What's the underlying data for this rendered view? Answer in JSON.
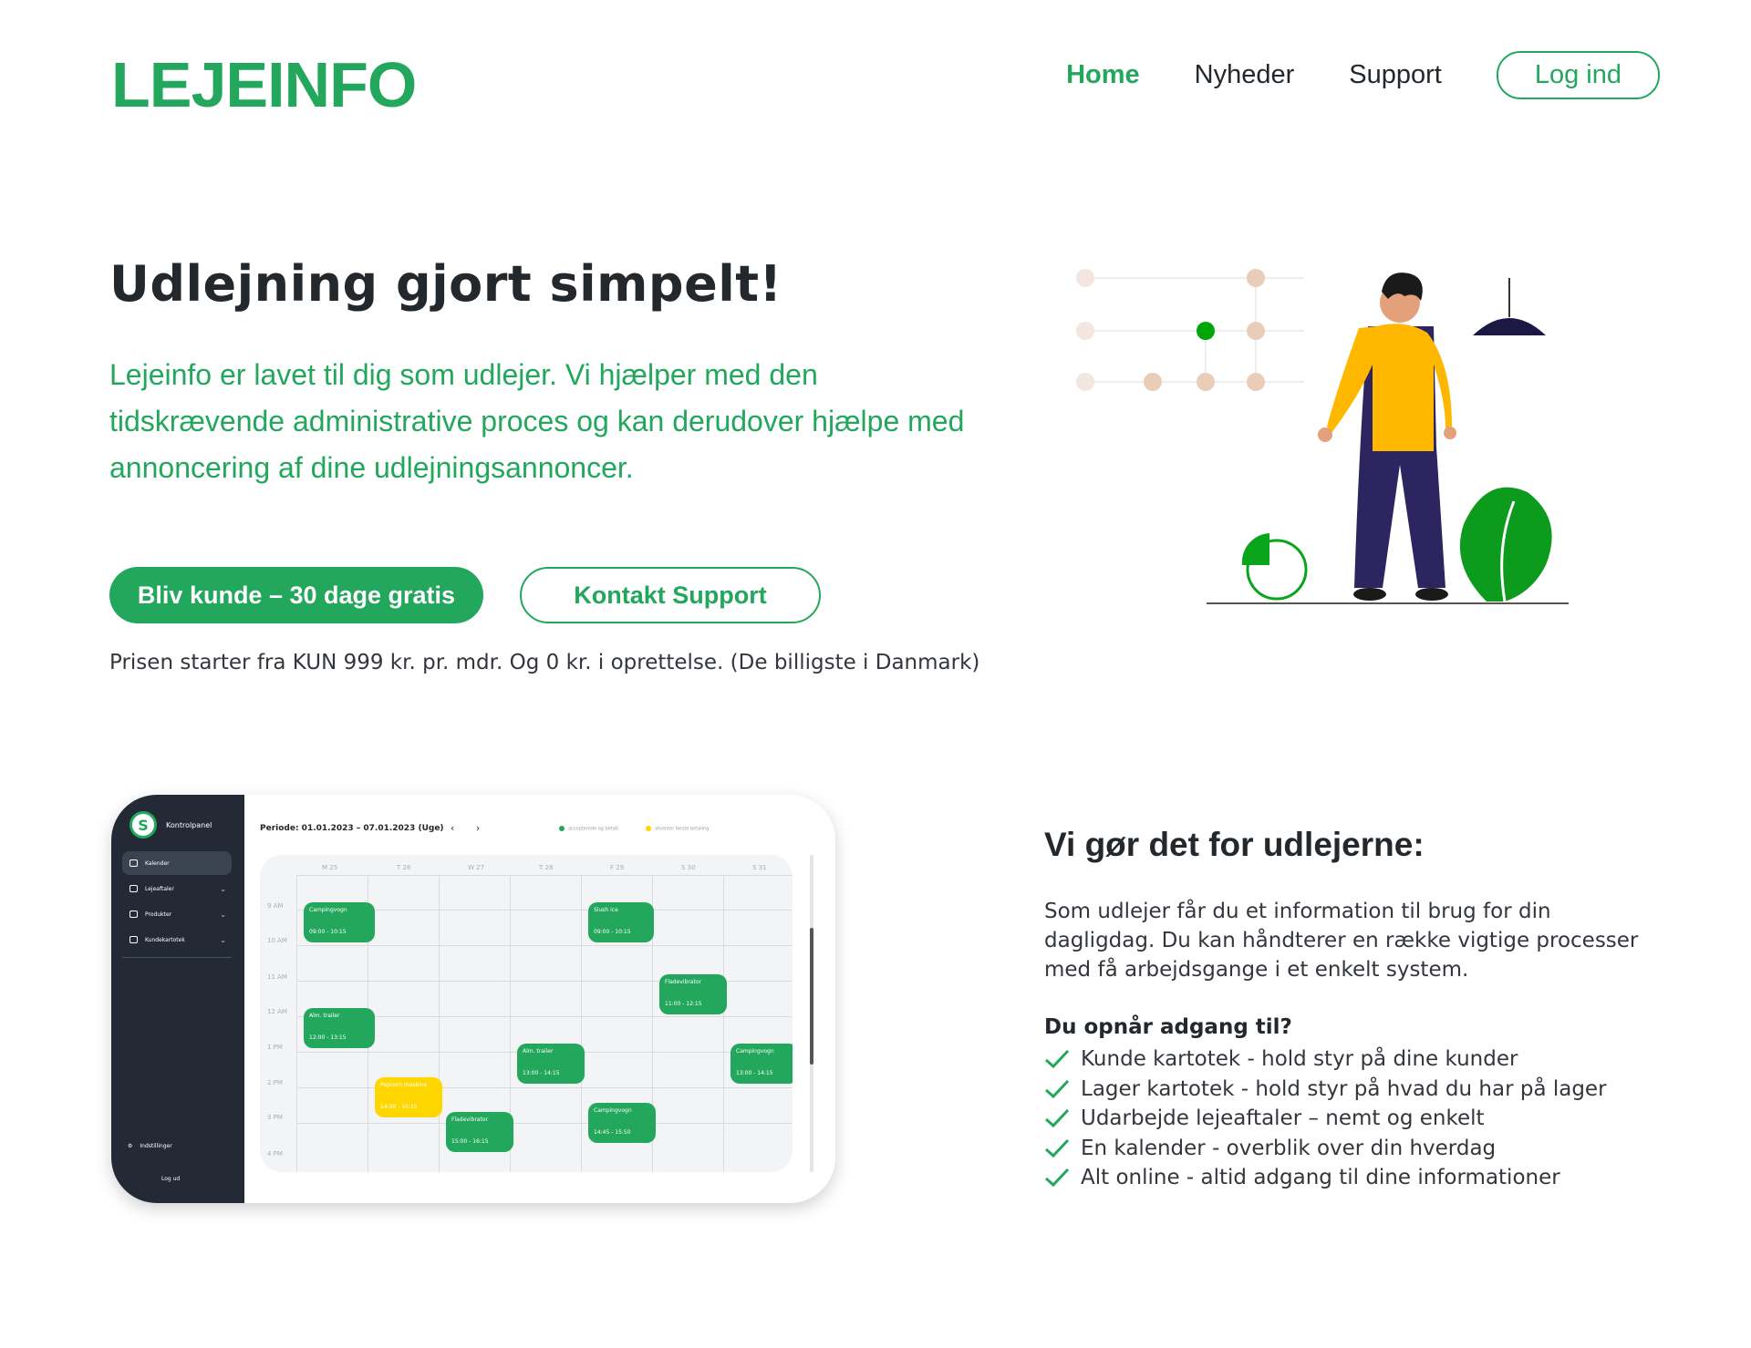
{
  "header": {
    "logo": "LEJEINFO",
    "nav": [
      "Home",
      "Nyheder",
      "Support"
    ],
    "login": "Log ind"
  },
  "hero": {
    "title": "Udlejning gjort simpelt!",
    "text": "Lejeinfo er lavet til dig som udlejer. Vi hjælper med den tidskrævende administrative proces og kan derudover hjælpe med annoncering af dine udlejningsannoncer.",
    "primary_button": "Bliv kunde – 30 dage gratis",
    "secondary_button": "Kontakt Support",
    "price_note": "Prisen starter fra KUN 999 kr. pr. mdr. Og 0 kr. i oprettelse. (De billigste i Danmark)"
  },
  "mockup": {
    "brand": "Kontrolpanel",
    "brand_initial": "S",
    "sidebar": [
      "Kalender",
      "Lejeaftaler",
      "Produkter",
      "Kundekartotek"
    ],
    "settings": "Indstillinger",
    "logout": "Log ud",
    "periode": "Periode: 01.01.2023 – 07.01.2023 (Uge)",
    "nav_arrows": "‹ ›",
    "legend": [
      "accepterede og betalt",
      "afventer første betaling"
    ],
    "days": [
      "M 25",
      "T 26",
      "W 27",
      "T 28",
      "F 29",
      "S 30",
      "S 31"
    ],
    "times": [
      "9 AM",
      "10 AM",
      "11 AM",
      "12 AM",
      "1 PM",
      "2 PM",
      "3 PM",
      "4 PM"
    ],
    "events": [
      {
        "title": "Campingvogn",
        "time": "09:00 - 10:15",
        "color": "green"
      },
      {
        "title": "Slush ice",
        "time": "09:00 - 10:15",
        "color": "green"
      },
      {
        "title": "Fladevibrator",
        "time": "11:00 - 12:15",
        "color": "green"
      },
      {
        "title": "Alm. trailer",
        "time": "12:00 - 13:15",
        "color": "green"
      },
      {
        "title": "Alm. trailer",
        "time": "13:00 - 14:15",
        "color": "green"
      },
      {
        "title": "Campingvogn",
        "time": "13:00 - 14:15",
        "color": "green"
      },
      {
        "title": "Popcorn maskine",
        "time": "14:00 - 15:15",
        "color": "yellow"
      },
      {
        "title": "Fladevibrator",
        "time": "15:00 - 16:15",
        "color": "green"
      },
      {
        "title": "Campingvogn",
        "time": "14:45 - 15:50",
        "color": "green"
      }
    ]
  },
  "features": {
    "title": "Vi gør det for udlejerne:",
    "text": "Som udlejer får du et information til brug for din dagligdag. Du kan håndterer en række vigtige processer med få arbejdsgange i et enkelt system.",
    "subtitle": "Du opnår adgang til?",
    "items": [
      "Kunde kartotek - hold styr på dine kunder",
      "Lager kartotek - hold styr på hvad du har på lager",
      "Udarbejde lejeaftaler – nemt og enkelt",
      "En kalender - overblik over din hverdag",
      "Alt online - altid adgang til dine informationer"
    ]
  },
  "colors": {
    "brand": "#22a75d",
    "dark": "#232a35",
    "yellow": "#ffd600"
  }
}
